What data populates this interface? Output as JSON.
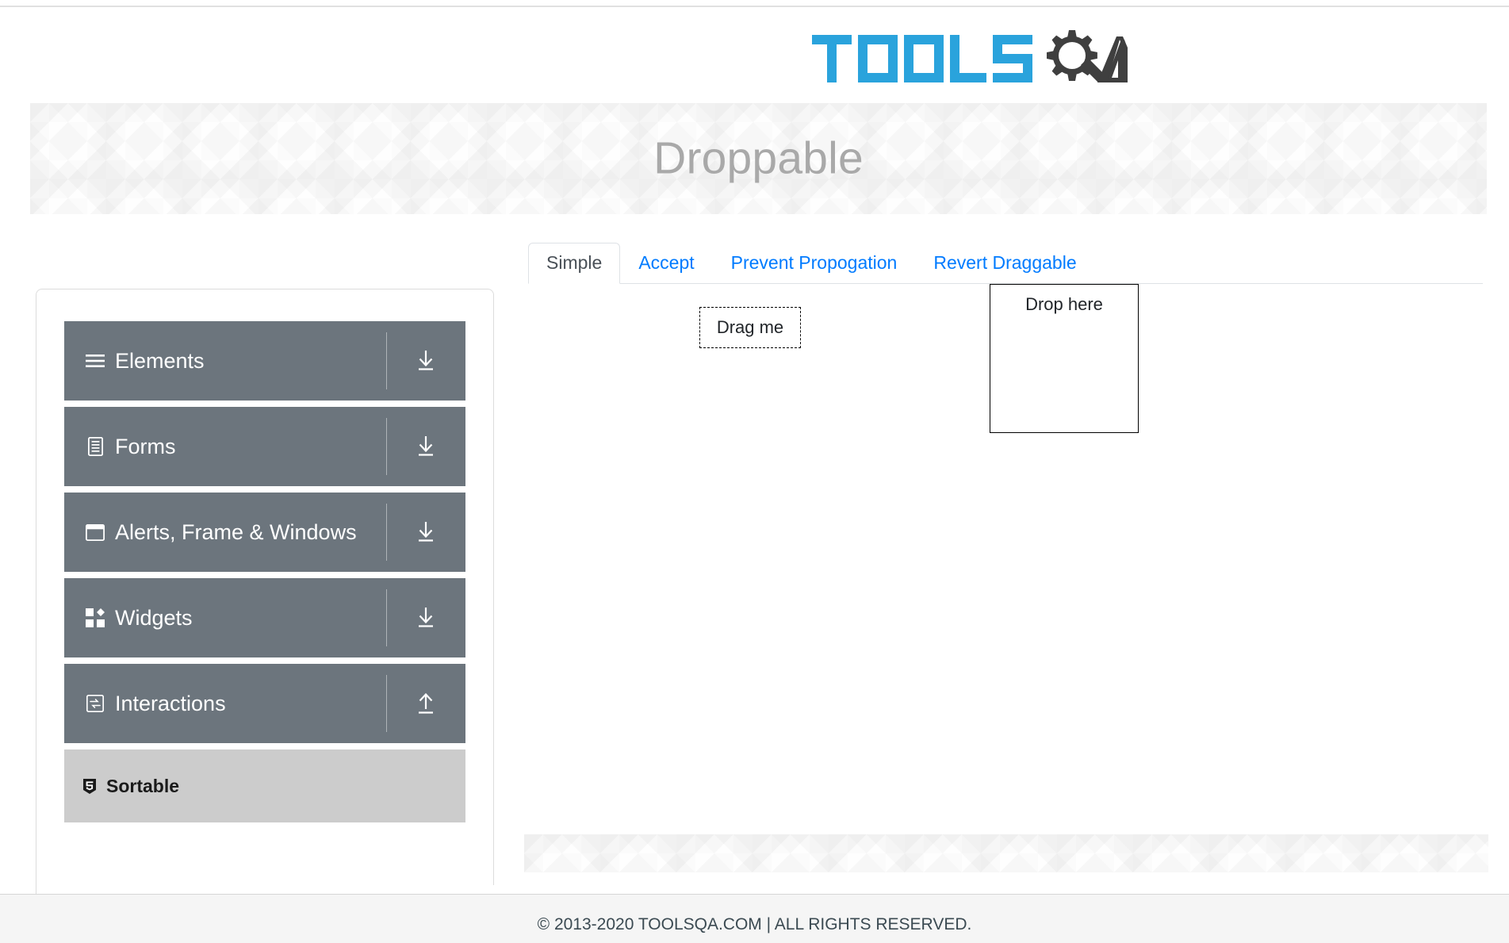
{
  "header": {
    "logo_text_primary": "TOOLS",
    "logo_text_secondary": "QA",
    "logo_primary_color": "#2aa3dc",
    "logo_secondary_color": "#3f3f3f"
  },
  "banner": {
    "title": "Droppable"
  },
  "sidebar": {
    "groups": [
      {
        "label": "Elements",
        "icon": "hamburger-menu-icon",
        "toggle": "arrow-down-icon",
        "expanded": false
      },
      {
        "label": "Forms",
        "icon": "document-list-icon",
        "toggle": "arrow-down-icon",
        "expanded": false
      },
      {
        "label": "Alerts, Frame & Windows",
        "icon": "browser-window-icon",
        "toggle": "arrow-down-icon",
        "expanded": false
      },
      {
        "label": "Widgets",
        "icon": "widgets-grid-icon",
        "toggle": "arrow-down-icon",
        "expanded": false
      },
      {
        "label": "Interactions",
        "icon": "sync-arrows-icon",
        "toggle": "arrow-up-icon",
        "expanded": true
      }
    ],
    "sub_items": [
      {
        "label": "Sortable",
        "icon": "html5-shield-icon",
        "selected": true
      }
    ]
  },
  "content": {
    "tabs": [
      {
        "label": "Simple",
        "active": true
      },
      {
        "label": "Accept",
        "active": false
      },
      {
        "label": "Prevent Propogation",
        "active": false
      },
      {
        "label": "Revert Draggable",
        "active": false
      }
    ],
    "simple_panel": {
      "draggable_label": "Drag me",
      "droppable_label": "Drop here"
    }
  },
  "footer": {
    "copyright": "© 2013-2020 TOOLSQA.COM | ALL RIGHTS RESERVED."
  },
  "colors": {
    "group_background": "#6c757d",
    "sub_item_background": "#cccccc",
    "link_blue": "#007bff",
    "banner_title": "#a9a9a9"
  }
}
